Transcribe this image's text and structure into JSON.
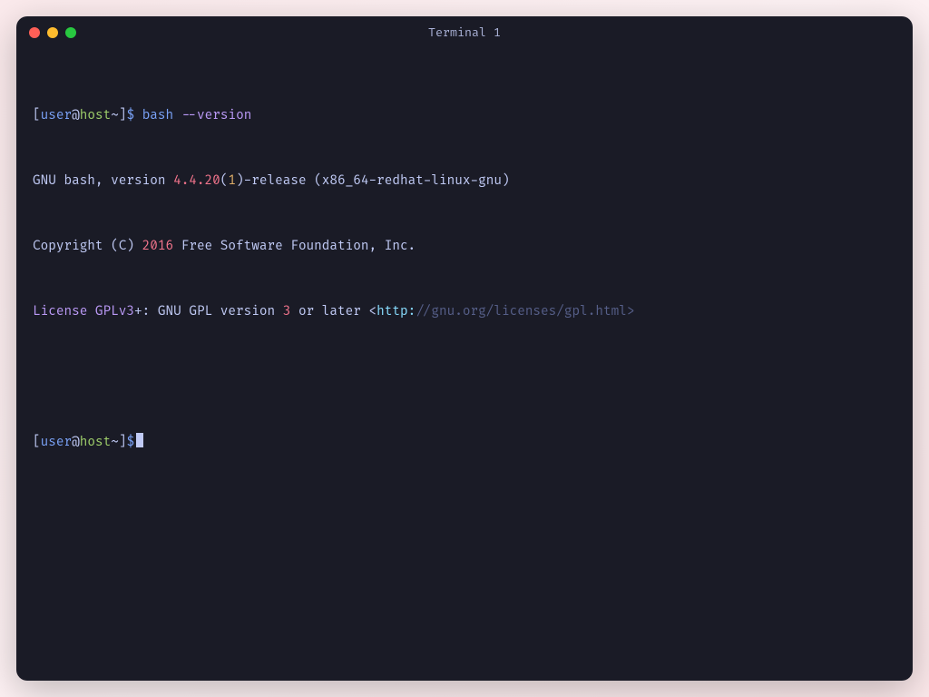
{
  "window": {
    "title": "Terminal 1"
  },
  "prompt": {
    "open_bracket": "[",
    "user": "user",
    "at": "@",
    "host": "host",
    "tilde": "~",
    "close_bracket": "]",
    "symbol": "$"
  },
  "command": {
    "name": "bash",
    "flag": "--version"
  },
  "output": {
    "line1": {
      "prefix": "GNU bash, version ",
      "version": "4.4.20",
      "paren_open": "(",
      "build": "1",
      "paren_close": ")",
      "suffix": "-release (x86_64-redhat-linux-gnu)"
    },
    "line2": {
      "prefix": "Copyright (C) ",
      "year": "2016",
      "suffix": " Free Software Foundation, Inc."
    },
    "line3": {
      "license": "License GPLv3",
      "plus": "+: GNU GPL version ",
      "ver": "3",
      "mid": " or later ",
      "angle_open": "<",
      "proto": "http:",
      "rest": "//gnu.org/licenses/gpl.html>"
    }
  }
}
